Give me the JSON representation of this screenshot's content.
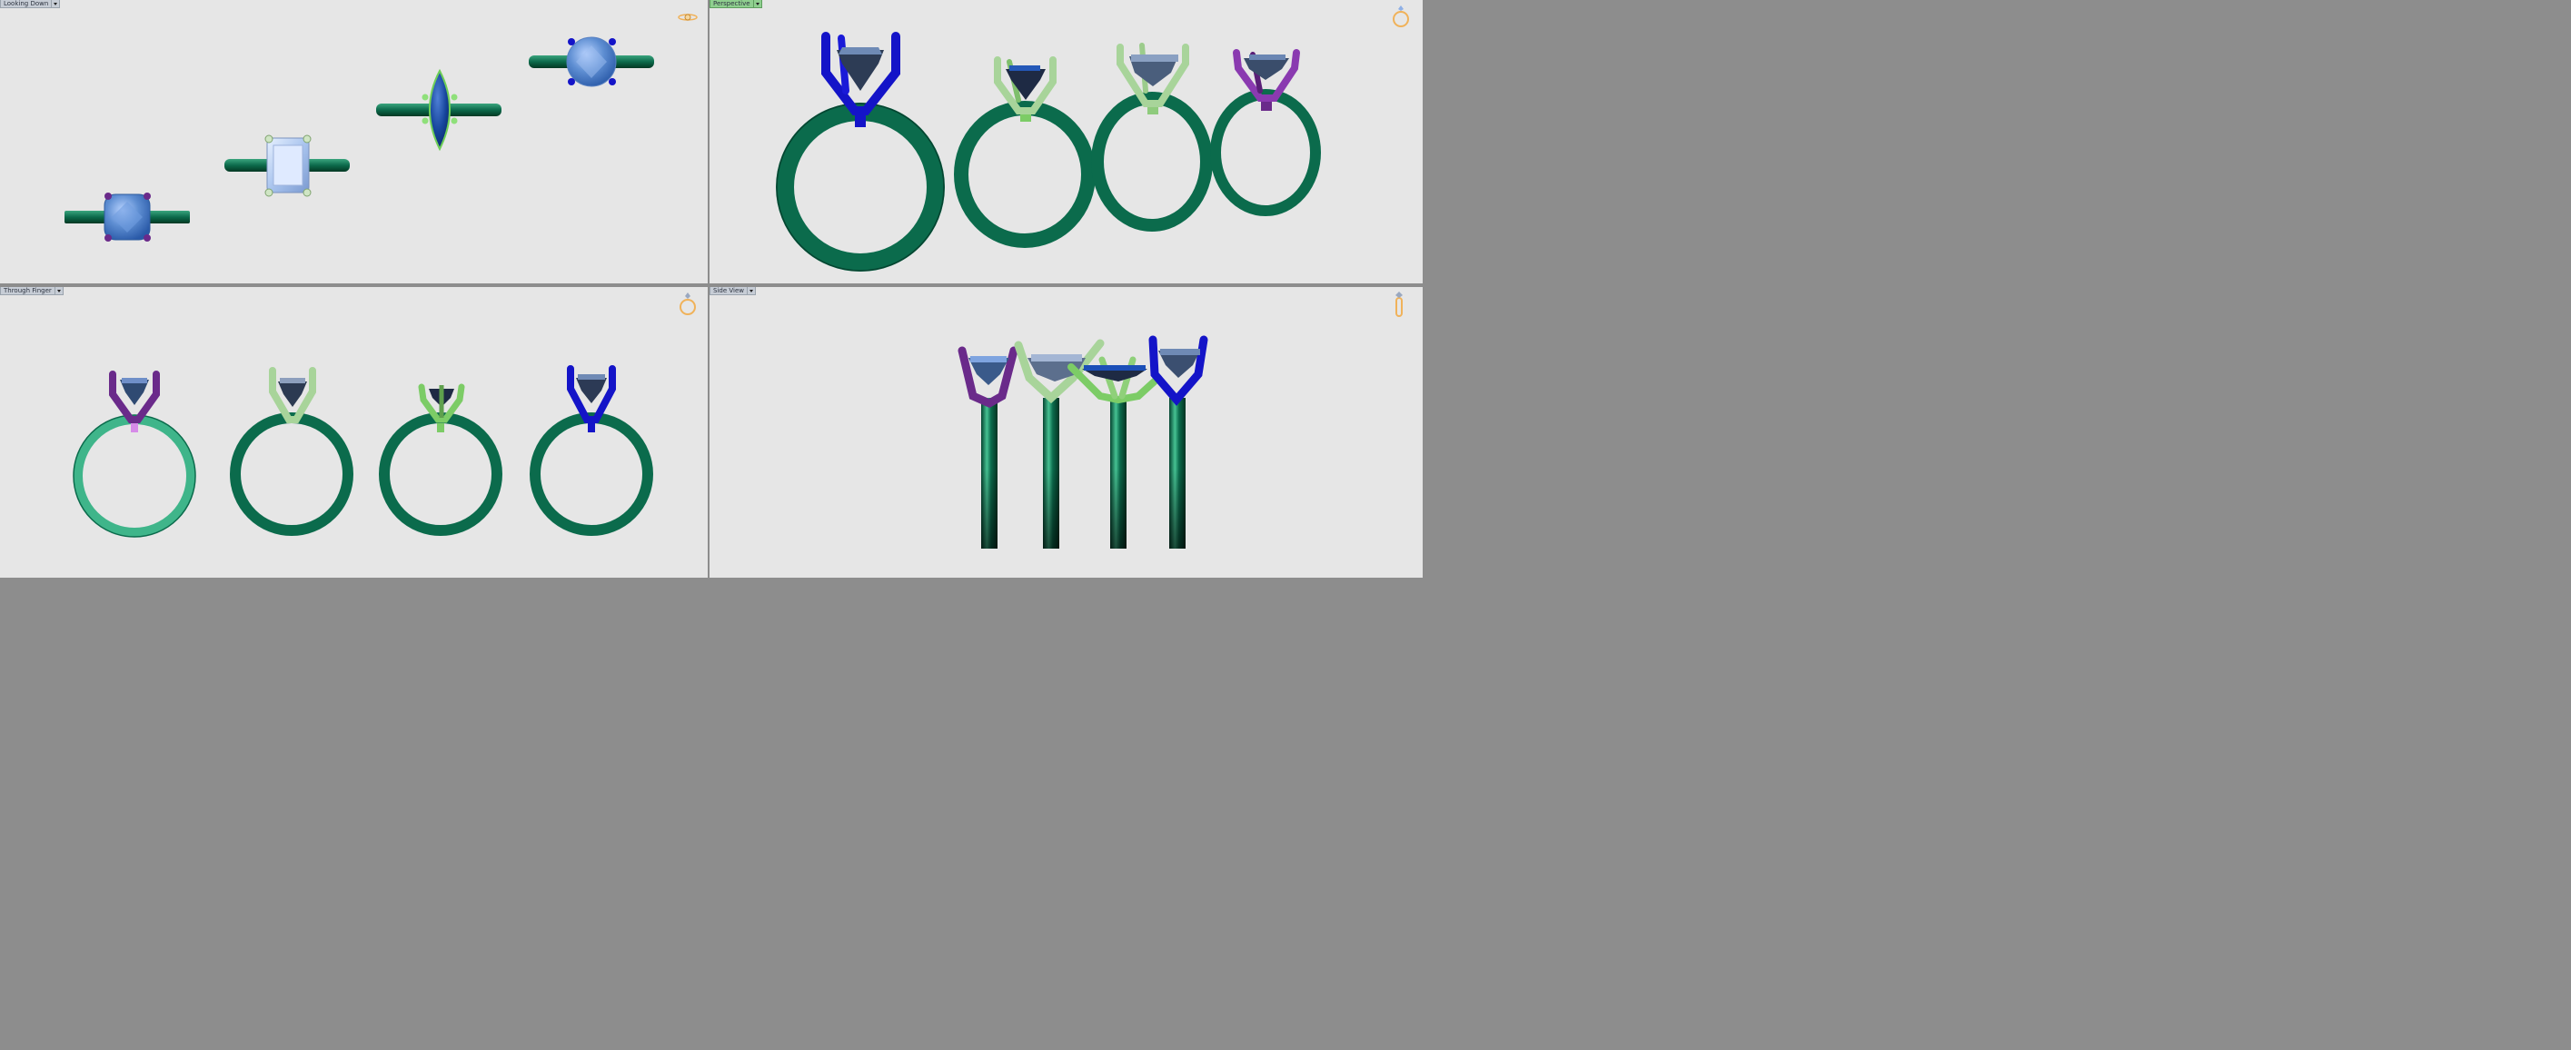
{
  "viewports": {
    "top_left": {
      "label": "Looking Down",
      "active": false
    },
    "top_right": {
      "label": "Perspective",
      "active": true
    },
    "bottom_left": {
      "label": "Through Finger",
      "active": false
    },
    "bottom_right": {
      "label": "Side View",
      "active": false
    }
  },
  "colors": {
    "viewport_bg": "#e6e6e6",
    "frame": "#8d8d8d",
    "band": "#0b6b4c",
    "band_light": "#3fb58a",
    "gem_blue": "#4f7fc8",
    "gem_dark": "#163e8f",
    "prong_blue": "#1414c8",
    "prong_purple": "#6a2a8a",
    "prong_light_green": "#a8d49a",
    "prong_green": "#7ccc66",
    "nav_icon": "#f0b25a"
  },
  "icons": {
    "view_cube": "ring-orientation-icon",
    "dropdown": "chevron-down-icon"
  }
}
